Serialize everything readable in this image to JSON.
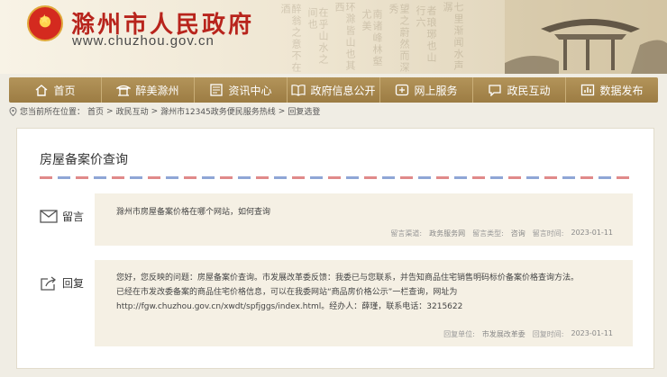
{
  "header": {
    "title": "滁州市人民政府",
    "url": "www.chuzhou.gov.cn"
  },
  "nav": {
    "items": [
      {
        "label": "首页",
        "icon": "home-icon"
      },
      {
        "label": "醉美滁州",
        "icon": "pavilion-icon"
      },
      {
        "label": "资讯中心",
        "icon": "news-icon"
      },
      {
        "label": "政府信息公开",
        "icon": "book-icon"
      },
      {
        "label": "网上服务",
        "icon": "service-icon"
      },
      {
        "label": "政民互动",
        "icon": "chat-icon"
      },
      {
        "label": "数据发布",
        "icon": "chart-icon"
      }
    ]
  },
  "breadcrumb": {
    "prefix": "您当前所在位置：",
    "items": [
      "首页",
      "政民互动",
      "滁州市12345政务便民服务热线",
      "回复选登"
    ],
    "separator": ">"
  },
  "article": {
    "title": "房屋备案价查询",
    "message": {
      "label": "留言",
      "text": "滁州市房屋备案价格在哪个网站，如何查询",
      "channel_key": "留言渠道:",
      "channel_value": "政务服务网",
      "type_key": "留言类型:",
      "type_value": "咨询",
      "time_key": "留言时间:",
      "time_value": "2023-01-11"
    },
    "reply": {
      "label": "回复",
      "line1": "您好，您反映的问题：房屋备案价查询。市发展改革委反馈：我委已与您联系，并告知商品住宅销售明码标价备案价格查询方法。",
      "line2": "已经在市发改委备案的商品住宅价格信息，可以在我委网站“商品房价格公示”一栏查询，网址为",
      "line3": "http://fgw.chuzhou.gov.cn/xwdt/spfjggs/index.html。经办人：薛瑾，联系电话：3215622",
      "unit_key": "回复单位:",
      "unit_value": "市发展改革委",
      "time_key": "回复时间:",
      "time_value": "2023-01-11"
    }
  },
  "colors": {
    "nav_bg": "#a88a4f",
    "title_red": "#b8241c",
    "box_bg": "#f5f0e4"
  }
}
